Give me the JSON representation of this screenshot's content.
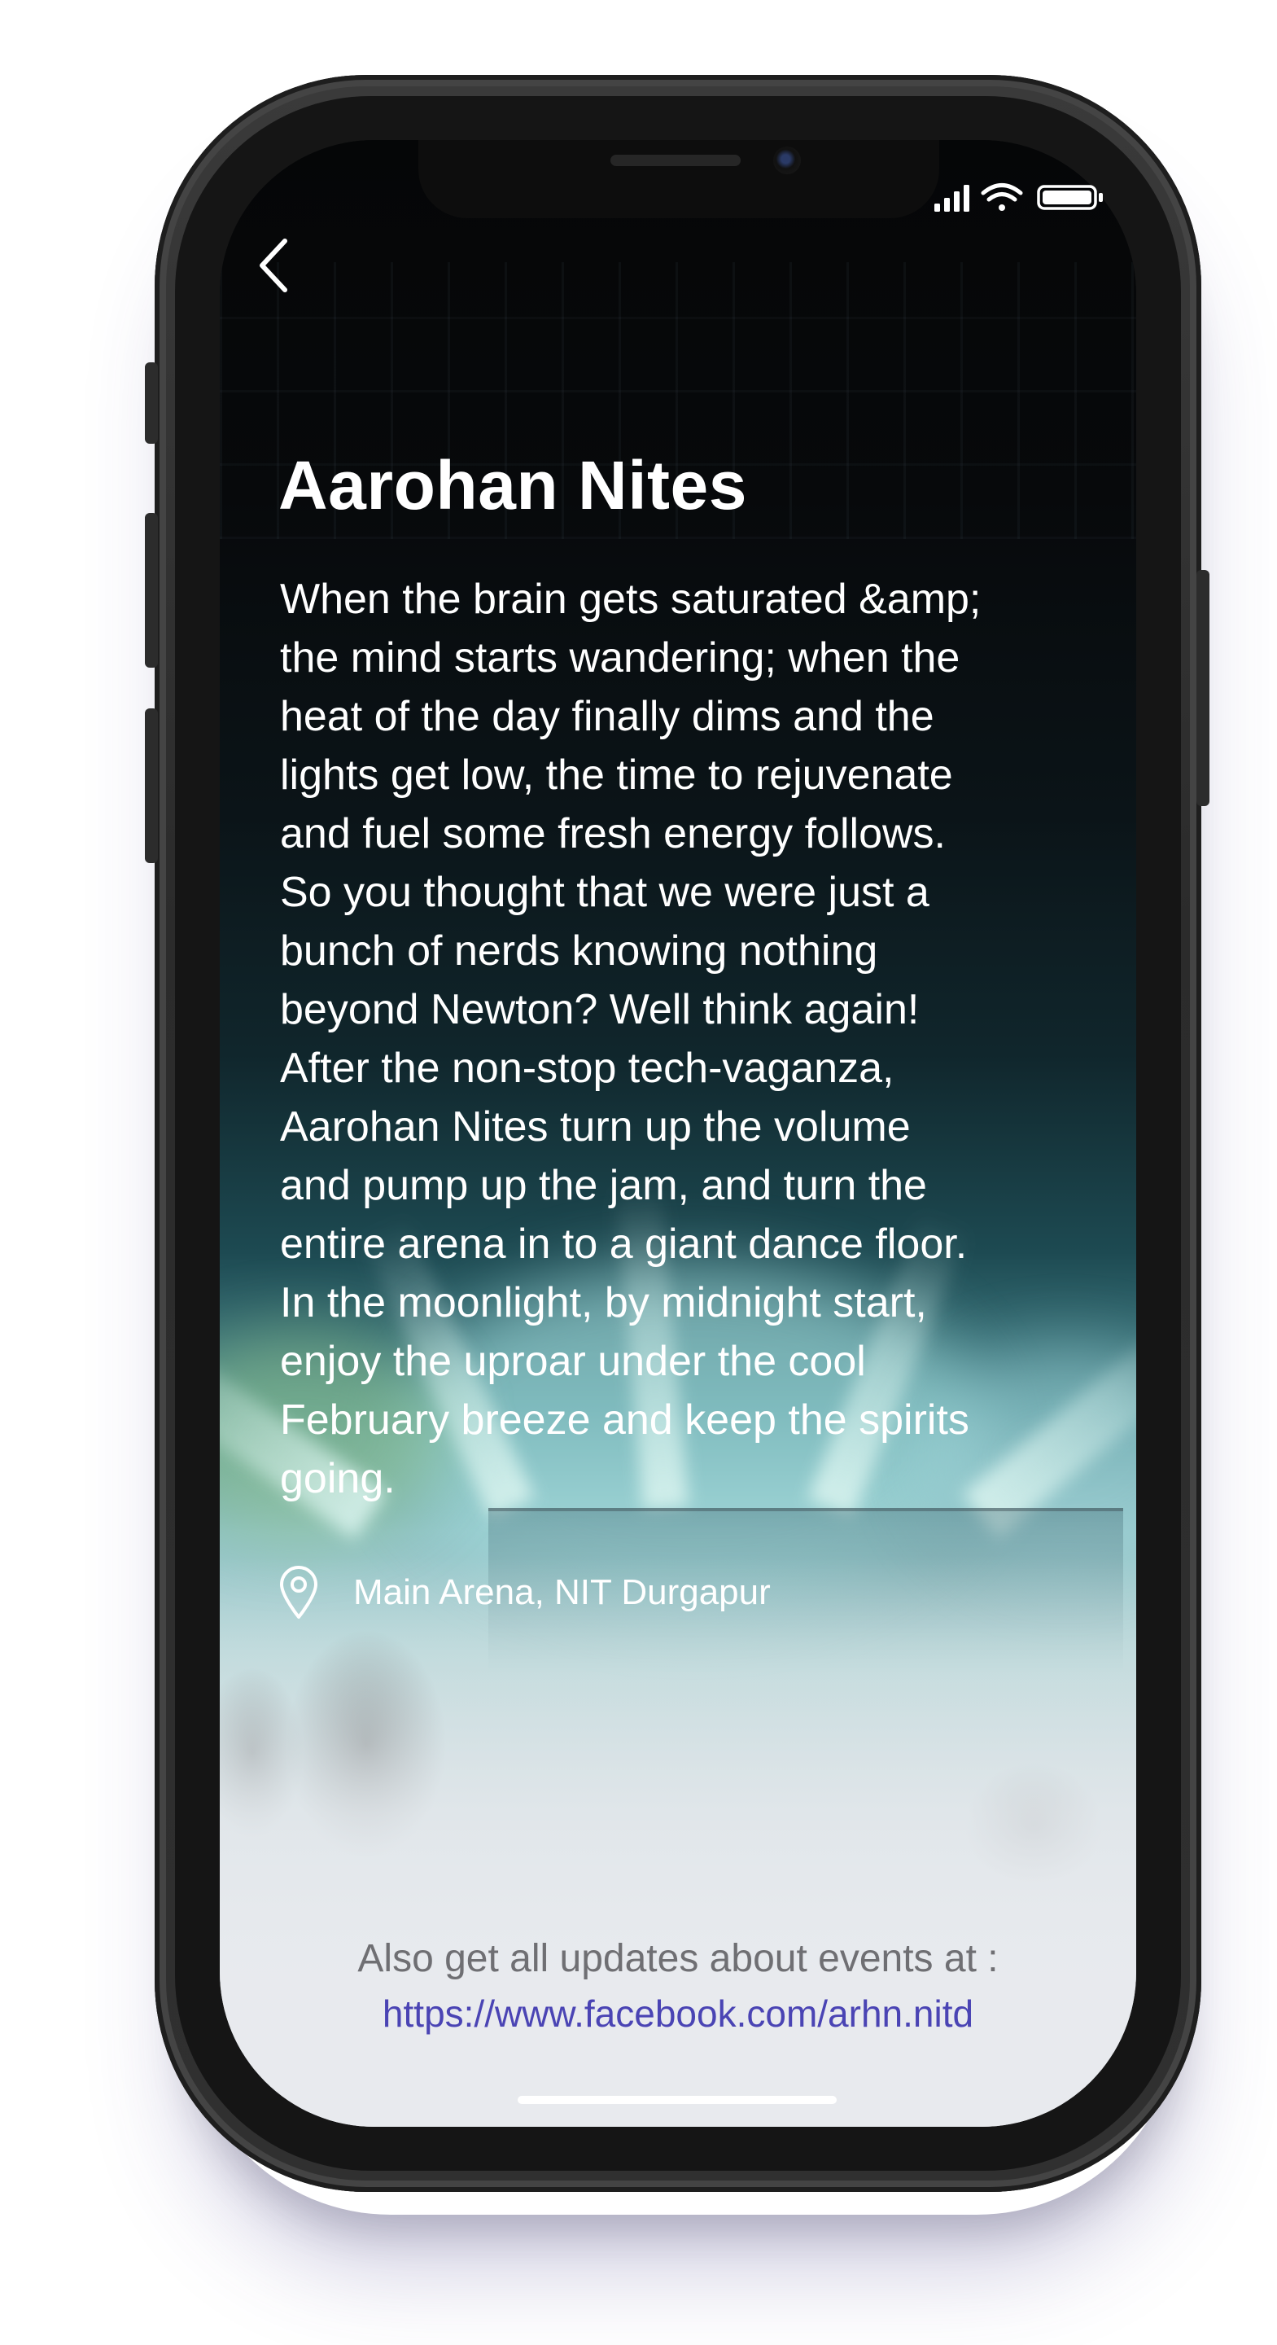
{
  "event": {
    "title": "Aarohan Nites",
    "description": "When the brain gets saturated &amp;\nthe mind starts wandering; when the\nheat of the day finally dims and the\nlights get low, the time to rejuvenate\nand fuel some fresh energy follows.\nSo you thought that we were just a\nbunch of nerds knowing nothing\nbeyond Newton? Well think again!\nAfter the non-stop tech-vaganza,\nAarohan Nites turn up the volume\nand pump up the jam, and turn the\nentire arena in to a giant dance floor.\nIn the moonlight, by midnight start,\nenjoy the uproar under the cool\nFebruary breeze and keep the spirits\ngoing.",
    "location": "Main Arena, NIT Durgapur"
  },
  "footer": {
    "note": "Also get all updates about events at :",
    "link": "https://www.facebook.com/arhn.nitd"
  },
  "icons": {
    "back": "chevron-left-icon",
    "location": "map-pin-icon",
    "signal": "signal-bars-icon",
    "wifi": "wifi-icon",
    "battery": "battery-icon"
  },
  "colors": {
    "title_text": "#ffffff",
    "footer_note": "#6f6f73",
    "link": "#4a44b4",
    "phone_frame": "#2e2e2e"
  }
}
